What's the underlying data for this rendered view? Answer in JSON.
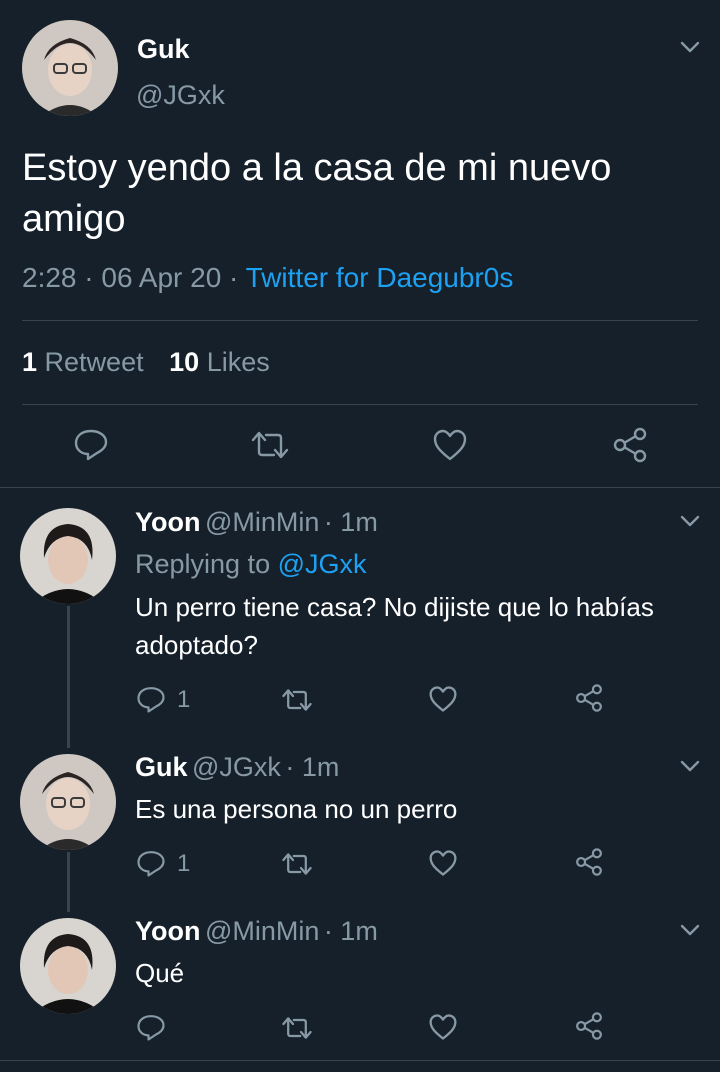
{
  "main_tweet": {
    "display_name": "Guk",
    "handle": "@JGxk",
    "text": "Estoy yendo a la casa de mi nuevo amigo",
    "time": "2:28",
    "separator": "·",
    "date": "06 Apr 20",
    "source": "Twitter for Daegubr0s",
    "retweet_count": "1",
    "retweet_label": "Retweet",
    "like_count": "10",
    "like_label": "Likes"
  },
  "replies": [
    {
      "display_name": "Yoon",
      "handle": "@MinMin",
      "time": "· 1m",
      "replying_prefix": "Replying to",
      "replying_to": "@JGxk",
      "text": "Un perro tiene casa? No dijiste que lo habías adoptado?",
      "reply_count": "1"
    },
    {
      "display_name": "Guk",
      "handle": "@JGxk",
      "time": "· 1m",
      "text": "Es una persona no un perro",
      "reply_count": "1"
    },
    {
      "display_name": "Yoon",
      "handle": "@MinMin",
      "time": "· 1m",
      "text": "Qué",
      "reply_count": ""
    }
  ],
  "colors": {
    "background": "#15202b",
    "text_secondary": "#8899a6",
    "accent": "#1da1f2",
    "divider": "#38444d"
  }
}
